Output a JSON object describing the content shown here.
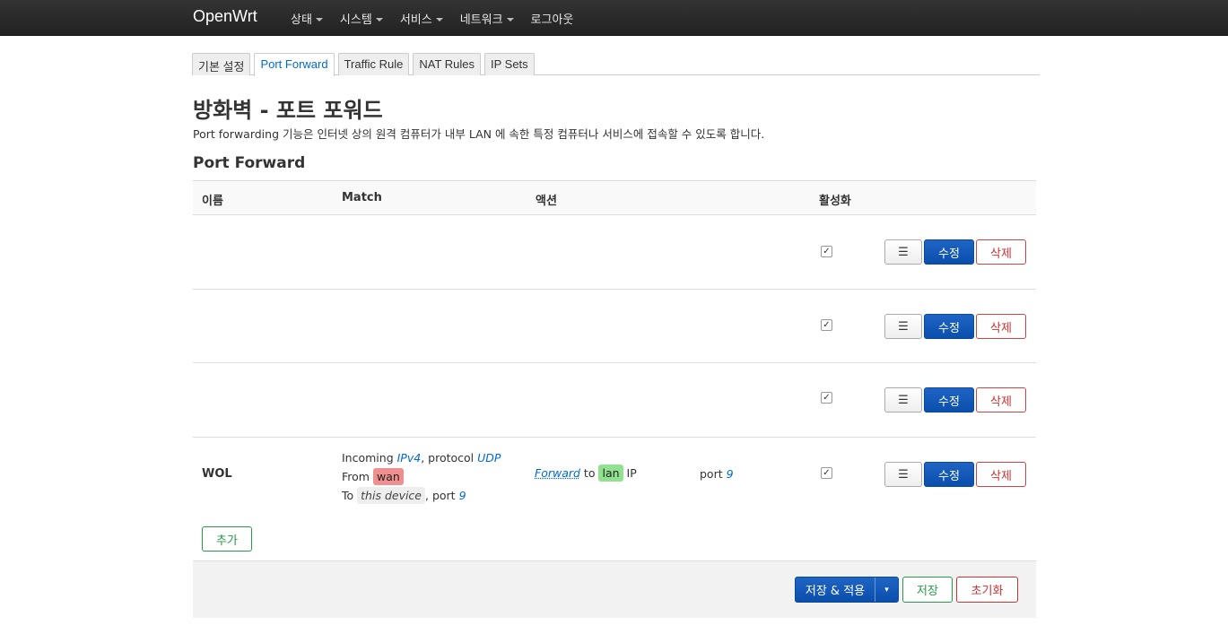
{
  "brand": "OpenWrt",
  "nav": [
    {
      "label": "상태",
      "has_caret": true
    },
    {
      "label": "시스템",
      "has_caret": true
    },
    {
      "label": "서비스",
      "has_caret": true
    },
    {
      "label": "네트워크",
      "has_caret": true
    },
    {
      "label": "로그아웃",
      "has_caret": false
    }
  ],
  "tabs": [
    {
      "label": "기본 설정",
      "active": false
    },
    {
      "label": "Port Forward",
      "active": true
    },
    {
      "label": "Traffic Rule",
      "active": false
    },
    {
      "label": "NAT Rules",
      "active": false
    },
    {
      "label": "IP Sets",
      "active": false
    }
  ],
  "page_title": "방화벽 - 포트 포워드",
  "page_description": "Port forwarding 기능은 인터넷 상의 원격 컴퓨터가 내부 LAN 에 속한 특정 컴퓨터나 서비스에 접속할 수 있도록 합니다.",
  "section_title": "Port Forward",
  "table": {
    "headers": {
      "name": "이름",
      "match": "Match",
      "action": "액션",
      "enabled": "활성화"
    },
    "row_buttons": {
      "menu": "☰",
      "edit": "수정",
      "delete": "삭제"
    },
    "rows": [
      {
        "name": "",
        "enabled": true
      },
      {
        "name": "",
        "enabled": true
      },
      {
        "name": "",
        "enabled": true
      },
      {
        "name": "WOL",
        "enabled": true,
        "match": {
          "incoming": "Incoming",
          "family": "IPv4",
          "protocol_label": ", protocol",
          "protocol": "UDP",
          "from_label": "From",
          "from_zone": "wan",
          "to_label": "To",
          "to_device": "this device",
          "port_label": ", port",
          "port": "9"
        },
        "action": {
          "verb": "Forward",
          "to_label": "to",
          "zone": "lan",
          "ip_label": "IP",
          "port_label": "port",
          "port": "9"
        }
      }
    ]
  },
  "add_button": "추가",
  "footer": {
    "save_apply": "저장 & 적용",
    "dropdown": "▾",
    "save": "저장",
    "reset": "초기화"
  },
  "colors": {
    "primary": "#0b4fad",
    "success": "#2a9a4a",
    "danger": "#cc3333",
    "zone_wan": "#ef8f8f",
    "zone_lan": "#90e290"
  }
}
